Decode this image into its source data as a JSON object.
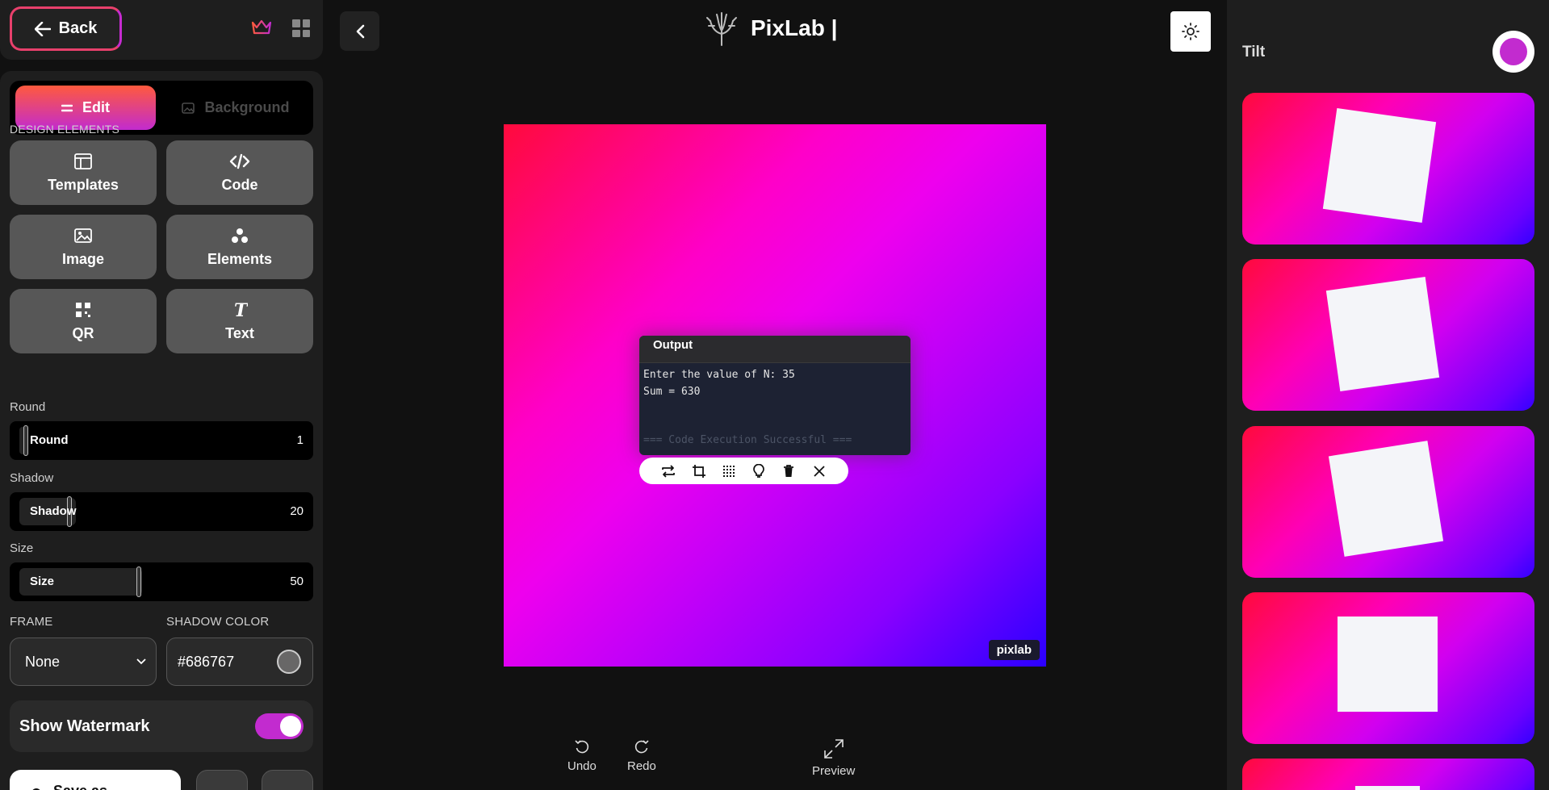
{
  "sidebar": {
    "back_label": "Back",
    "tabs": {
      "edit": "Edit",
      "background": "Background"
    },
    "design_elements_label": "DESIGN ELEMENTS",
    "design_items": [
      {
        "label": "Templates",
        "icon": "layout-icon"
      },
      {
        "label": "Code",
        "icon": "code-icon"
      },
      {
        "label": "Image",
        "icon": "image-icon"
      },
      {
        "label": "Elements",
        "icon": "elements-icon"
      },
      {
        "label": "QR",
        "icon": "qr-icon"
      },
      {
        "label": "Text",
        "icon": "text-icon"
      }
    ],
    "sliders": {
      "round": {
        "section": "Round",
        "label": "Round",
        "value": "1"
      },
      "shadow": {
        "section": "Shadow",
        "label": "Shadow",
        "value": "20"
      },
      "size": {
        "section": "Size",
        "label": "Size",
        "value": "50"
      }
    },
    "frame_label": "FRAME",
    "frame_value": "None",
    "shadow_color_label": "SHADOW COLOR",
    "shadow_color_value": "#686767",
    "show_watermark_label": "Show Watermark",
    "save_label": "Save as"
  },
  "header": {
    "app_name": "PixLab |"
  },
  "canvas": {
    "output_title": "Output",
    "output_lines": [
      "Enter the value of N: 35",
      "Sum = 630"
    ],
    "output_footer": "=== Code Execution Successful ===",
    "watermark": "pixlab"
  },
  "bottom_actions": {
    "undo": "Undo",
    "redo": "Redo",
    "preview": "Preview"
  },
  "right_panel": {
    "title": "Tilt"
  },
  "colors": {
    "accent": "#c22bcf",
    "accent_orange": "#ff5a3d",
    "shadow_color": "#686767"
  }
}
